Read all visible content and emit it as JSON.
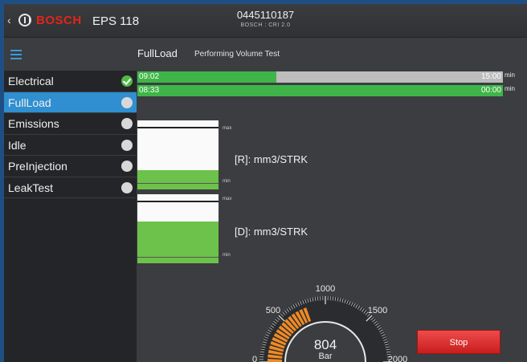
{
  "header": {
    "back_glyph": "‹",
    "brand": "BOSCH",
    "model": "EPS 118",
    "part_number": "0445110187",
    "part_sub": "BOSCH : CRI 2.0"
  },
  "sidebar": {
    "items": [
      {
        "label": "Electrical",
        "status": "done"
      },
      {
        "label": "FullLoad",
        "status": "active"
      },
      {
        "label": "Emissions",
        "status": "pending"
      },
      {
        "label": "Idle",
        "status": "pending"
      },
      {
        "label": "PreInjection",
        "status": "pending"
      },
      {
        "label": "LeakTest",
        "status": "pending"
      }
    ]
  },
  "main": {
    "title": "FullLoad",
    "subtitle": "Performing Volume Test",
    "bars": [
      {
        "elapsed": "09:02",
        "total": "15:00",
        "unit": "min",
        "progress": 0.38
      },
      {
        "elapsed": "08:33",
        "total": "00:00",
        "unit": "min",
        "progress": 1.0
      }
    ],
    "volume": [
      {
        "unit_label": "[R]: mm3/STRK",
        "max_label": "max",
        "min_label": "min",
        "level": 0.28
      },
      {
        "unit_label": "[D]: mm3/STRK",
        "max_label": "max",
        "min_label": "min",
        "level": 0.6
      }
    ],
    "gauge": {
      "value": "804",
      "unit": "Bar",
      "ticks": [
        "0",
        "500",
        "1000",
        "1500",
        "2000"
      ],
      "max": 2000,
      "reading": 804,
      "accent": "#f08a24"
    },
    "stop_label": "Stop"
  },
  "colors": {
    "active": "#2f8fd0",
    "done": "#53b848",
    "progress": "#3fb549",
    "brand": "#e1251b",
    "stop": "#d92b2b"
  }
}
